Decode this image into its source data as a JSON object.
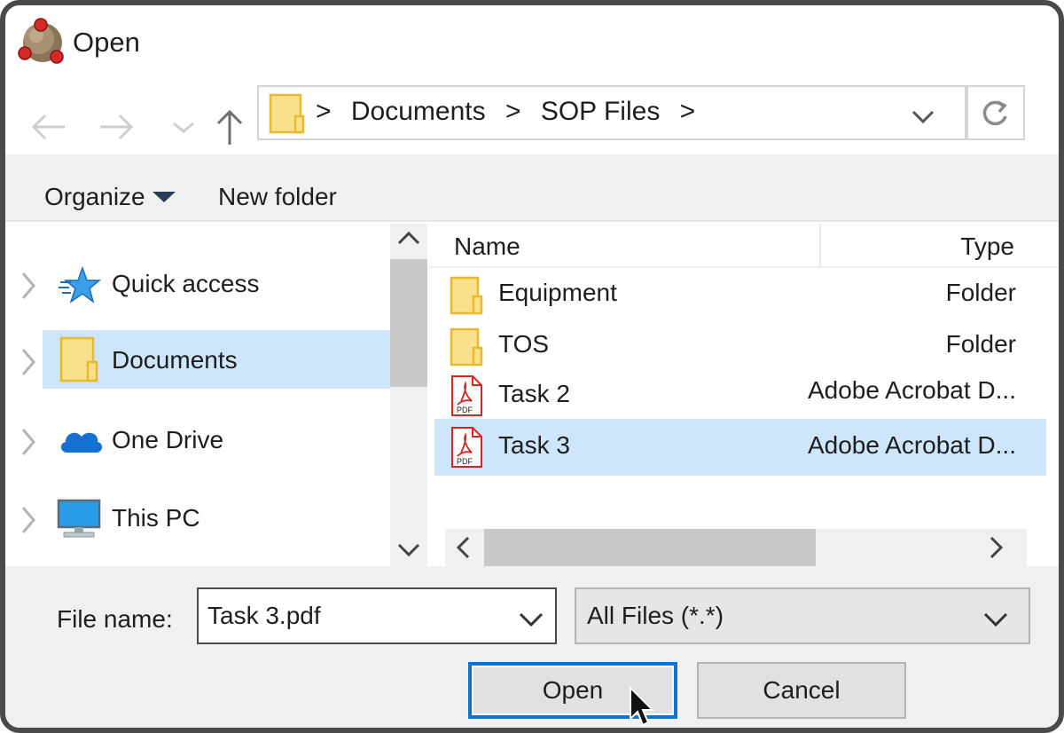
{
  "window": {
    "title": "Open",
    "app_icon": "molecule-icon"
  },
  "nav": {
    "back_icon": "arrow-left-icon",
    "forward_icon": "arrow-right-icon",
    "recent_icon": "chevron-down-icon",
    "up_icon": "arrow-up-icon"
  },
  "address": {
    "sep1": ">",
    "crumb1": "Documents",
    "sep2": ">",
    "crumb2": "SOP Files",
    "sep3": ">",
    "dropdown_icon": "chevron-down-icon",
    "refresh_icon": "refresh-icon"
  },
  "toolbar": {
    "organize": "Organize",
    "new_folder": "New folder"
  },
  "sidebar": {
    "items": [
      {
        "label": "Quick access",
        "icon": "star-icon",
        "selected": false
      },
      {
        "label": "Documents",
        "icon": "folder-icon",
        "selected": true
      },
      {
        "label": "One Drive",
        "icon": "cloud-icon",
        "selected": false
      },
      {
        "label": "This PC",
        "icon": "monitor-icon",
        "selected": false
      }
    ]
  },
  "files": {
    "columns": {
      "name": "Name",
      "type": "Type"
    },
    "rows": [
      {
        "name": "Equipment",
        "type": "Folder",
        "icon": "folder-icon",
        "selected": false
      },
      {
        "name": "TOS",
        "type": "Folder",
        "icon": "folder-icon",
        "selected": false
      },
      {
        "name": "Task 2",
        "type": "Adobe Acrobat D...",
        "icon": "pdf-icon",
        "selected": false
      },
      {
        "name": "Task 3",
        "type": "Adobe Acrobat D...",
        "icon": "pdf-icon",
        "selected": true
      }
    ],
    "pdf_badge": "PDF"
  },
  "footer": {
    "filename_label": "File name:",
    "filename_value": "Task 3.pdf",
    "filetype_value": "All Files (*.*)",
    "open_label": "Open",
    "cancel_label": "Cancel"
  },
  "colors": {
    "selection": "#cde6fb",
    "focus_border": "#0b74d0",
    "folder_fill": "#fbe08c",
    "folder_stroke": "#e6b930",
    "pdf_red": "#d9231e"
  }
}
